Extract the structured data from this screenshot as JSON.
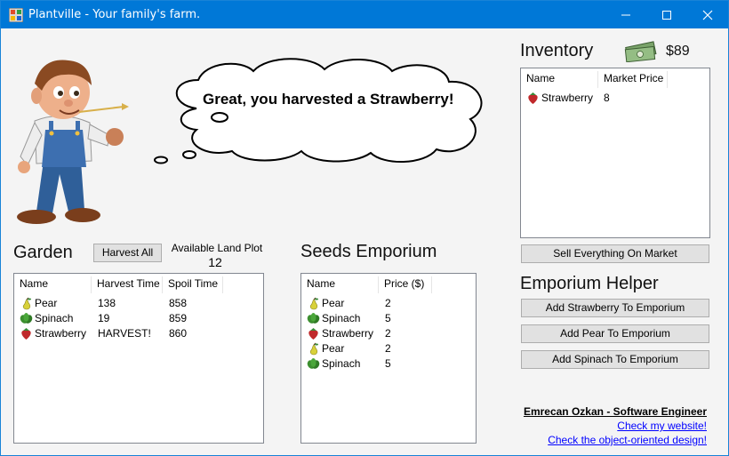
{
  "window": {
    "title": "Plantville - Your family's farm."
  },
  "speech_bubble": {
    "message": "Great, you harvested a Strawberry!"
  },
  "inventory": {
    "heading": "Inventory",
    "money": "$89",
    "columns": [
      "Name",
      "Market Price"
    ],
    "rows": [
      {
        "icon": "strawberry-icon",
        "name": "Strawberry",
        "price": "8"
      }
    ],
    "sell_button_label": "Sell Everything On Market"
  },
  "garden": {
    "heading": "Garden",
    "harvest_button_label": "Harvest All",
    "land_plot_label": "Available Land Plot",
    "land_plot_value": "12",
    "columns": [
      "Name",
      "Harvest Time",
      "Spoil Time"
    ],
    "rows": [
      {
        "icon": "pear-icon",
        "name": "Pear",
        "harvest": "138",
        "spoil": "858"
      },
      {
        "icon": "spinach-icon",
        "name": "Spinach",
        "harvest": "19",
        "spoil": "859"
      },
      {
        "icon": "strawberry-icon",
        "name": "Strawberry",
        "harvest": "HARVEST!",
        "spoil": "860"
      }
    ]
  },
  "seeds": {
    "heading": "Seeds Emporium",
    "columns": [
      "Name",
      "Price ($)"
    ],
    "rows": [
      {
        "icon": "pear-icon",
        "name": "Pear",
        "price": "2"
      },
      {
        "icon": "spinach-icon",
        "name": "Spinach",
        "price": "5"
      },
      {
        "icon": "strawberry-icon",
        "name": "Strawberry",
        "price": "2"
      },
      {
        "icon": "pear-icon",
        "name": "Pear",
        "price": "2"
      },
      {
        "icon": "spinach-icon",
        "name": "Spinach",
        "price": "5"
      }
    ]
  },
  "helper": {
    "heading": "Emporium Helper",
    "buttons": [
      "Add Strawberry To Emporium",
      "Add Pear To Emporium",
      "Add Spinach To Emporium"
    ]
  },
  "footer": {
    "author": "Emrecan Ozkan - Software Engineer",
    "website_link": "Check my website!",
    "design_link": "Check the object-oriented design!"
  },
  "colors": {
    "titlebar": "#0078d7",
    "link": "#0000ff"
  }
}
